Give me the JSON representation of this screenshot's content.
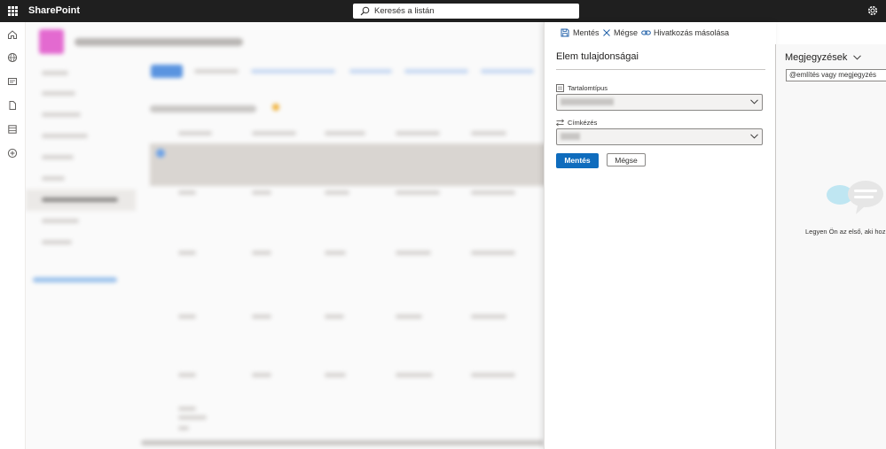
{
  "topbar": {
    "app_name": "SharePoint",
    "search_placeholder": "Keresés a listán"
  },
  "panel": {
    "commands": {
      "save": "Mentés",
      "cancel": "Mégse",
      "copy_link": "Hivatkozás másolása"
    },
    "title": "Elem tulajdonságai",
    "fields": {
      "content_type_label": "Tartalomtípus",
      "labeling_label": "Címkézés"
    },
    "buttons": {
      "save": "Mentés",
      "cancel": "Mégse"
    }
  },
  "comments": {
    "title": "Megjegyzések",
    "input_placeholder": "@említés vagy megjegyzés",
    "empty_text": "Legyen Ön az első, aki hoz"
  },
  "colors": {
    "topbar_bg": "#1f1f1f",
    "primary": "#0f6cbd",
    "accent_icon": "#1f5fa8"
  },
  "icons": {
    "waffle": "app-launcher-icon",
    "search": "search-icon",
    "settings": "gear-icon",
    "save": "save-icon",
    "cancel": "close-icon",
    "link": "link-icon",
    "content_type": "content-type-icon",
    "labeling": "labeling-icon",
    "chevron": "chevron-down-icon"
  }
}
